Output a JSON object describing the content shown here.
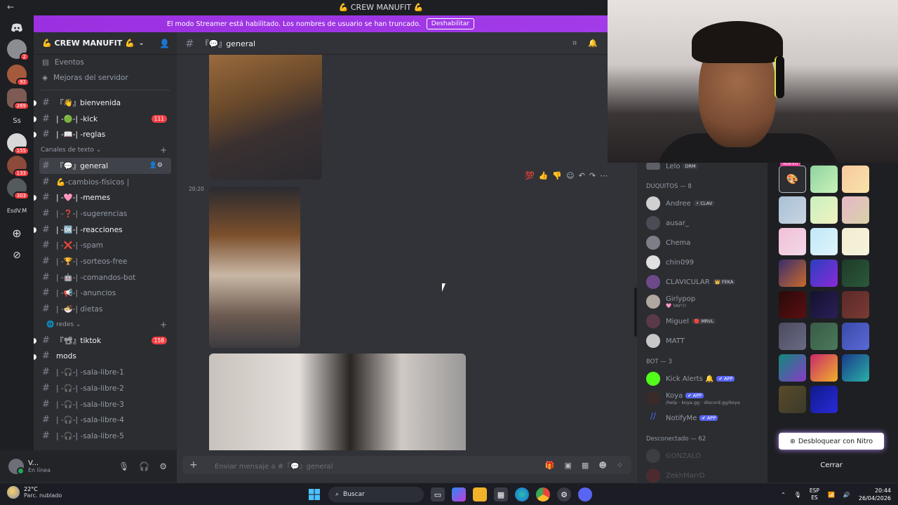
{
  "window": {
    "title": "💪 CREW MANUFIT 💪",
    "back": "←"
  },
  "streamer_banner": {
    "text": "El modo Streamer está habilitado. Los nombres de usuario se han truncado.",
    "button": "Deshabilitar"
  },
  "rail": {
    "items": [
      {
        "label": "",
        "badge": ""
      },
      {
        "label": "",
        "badge": "2"
      },
      {
        "label": "",
        "badge": "92"
      },
      {
        "label": "",
        "badge": "269"
      },
      {
        "label": "Ss",
        "badge": ""
      },
      {
        "label": "",
        "badge": "155"
      },
      {
        "label": "",
        "badge": "133"
      },
      {
        "label": "",
        "badge": "303"
      },
      {
        "label": "EsdV.M",
        "badge": ""
      }
    ]
  },
  "server": {
    "name": "💪 CREW MANUFIT 💪",
    "links": [
      "Eventos",
      "Mejoras del servidor"
    ],
    "channels_top": [
      {
        "name": "『👋』bienvenida",
        "unread": true,
        "pill": ""
      },
      {
        "name": "| -🟢-| -kick",
        "unread": true,
        "pill": "111"
      },
      {
        "name": "| -📖-| -reglas",
        "unread": true,
        "pill": ""
      }
    ],
    "category_text": "Canales de texto ⌄",
    "channels_text": [
      {
        "name": "『💬』general",
        "unread": false,
        "active": true
      },
      {
        "name": "💪-cambios-físicos |",
        "unread": false
      },
      {
        "name": "| -🩷-| -memes",
        "unread": true
      },
      {
        "name": "| -❓-| -sugerencias",
        "unread": false
      },
      {
        "name": "| -🆗-| -reacciones",
        "unread": true
      },
      {
        "name": "| -❌-| -spam",
        "unread": false
      },
      {
        "name": "| -🏆-| -sorteos-free",
        "unread": false
      },
      {
        "name": "| -🤖-| -comandos-bot",
        "unread": false
      },
      {
        "name": "| -📢-| -anuncios",
        "unread": false
      },
      {
        "name": "| -🍜-| dietas",
        "unread": false
      }
    ],
    "category_redes": "🌐 redes ⌄",
    "channels_redes": [
      {
        "name": "『📽』tiktok",
        "unread": true,
        "pill": "158"
      },
      {
        "name": "mods",
        "unread": true,
        "pill": ""
      },
      {
        "name": "| -🎧-| -sala-libre-1",
        "unread": false
      },
      {
        "name": "| -🎧-| -sala-libre-2",
        "unread": false
      },
      {
        "name": "| -🎧-| -sala-libre-3",
        "unread": false
      },
      {
        "name": "| -🎧-| -sala-libre-4",
        "unread": false
      },
      {
        "name": "| -🎧-| -sala-libre-5",
        "unread": false
      }
    ]
  },
  "user": {
    "name": "V...",
    "status": "En línea"
  },
  "chat": {
    "channel": "『💬』general",
    "timestamp": "20:20",
    "composer_placeholder": "Enviar mensaje a #『💬』general"
  },
  "members": {
    "top_partial": {
      "name": "Lelo",
      "tag": "DRM"
    },
    "group1": "DUQUITOS — 8",
    "duquitos": [
      {
        "name": "Andree",
        "tag": "⚡ CLAV",
        "sub": "",
        "color": "#949ba4"
      },
      {
        "name": "ausar_",
        "tag": "",
        "sub": "",
        "color": "#949ba4"
      },
      {
        "name": "Chema",
        "tag": "",
        "sub": "",
        "color": "#949ba4"
      },
      {
        "name": "chin099",
        "tag": "",
        "sub": "",
        "color": "#949ba4"
      },
      {
        "name": "CLAVICULAR",
        "tag": "👑 FEKA",
        "sub": "",
        "color": "#949ba4"
      },
      {
        "name": "Girlypop",
        "tag": "",
        "sub": "🩷 YAY!!!",
        "color": "#949ba4"
      },
      {
        "name": "Miguel",
        "tag": "🔴 MRVL",
        "sub": "",
        "color": "#949ba4"
      },
      {
        "name": "MATT",
        "tag": "",
        "sub": "",
        "color": "#949ba4"
      }
    ],
    "group2": "BOT — 3",
    "bots": [
      {
        "name": "Kick Alerts 🔔",
        "tag": "✔ APP",
        "sub": ""
      },
      {
        "name": "Koya",
        "tag": "✔ APP",
        "sub": "/help · koya.gg · discord.gg/koya"
      },
      {
        "name": "NotifyMe",
        "tag": "✔ APP",
        "sub": ""
      }
    ],
    "group3": "Desconectado — 62",
    "offline": [
      "GONZALO",
      "ZekhMarrD"
    ]
  },
  "picker": {
    "new_label": "NUEVO",
    "unlock": "Desbloquear con Nitro",
    "close": "Cerrar"
  },
  "taskbar": {
    "temp": "22°C",
    "weather": "Parc. nublado",
    "search": "Buscar",
    "lang1": "ESP",
    "lang2": "ES",
    "time": "20:44",
    "date": "26/04/2026"
  }
}
